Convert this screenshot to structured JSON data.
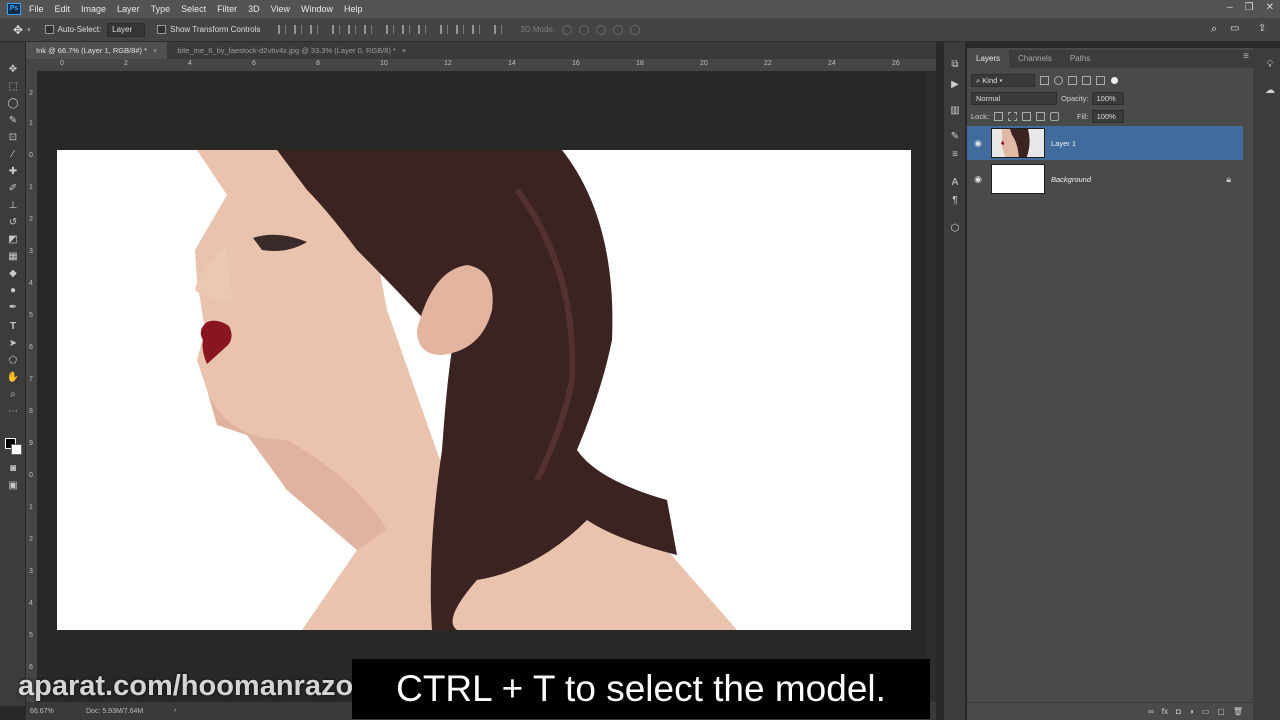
{
  "app": {
    "logo": "Ps",
    "menu": [
      "File",
      "Edit",
      "Image",
      "Layer",
      "Type",
      "Select",
      "Filter",
      "3D",
      "View",
      "Window",
      "Help"
    ],
    "window_controls": [
      "–",
      "❐",
      "✕"
    ]
  },
  "options_bar": {
    "auto_select_label": "Auto-Select:",
    "auto_select_value": "Layer",
    "show_transform_label": "Show Transform Controls",
    "mode_3d_label": "3D Mode:"
  },
  "tabs": [
    {
      "label": "Ink @ 66.7% (Layer 1, RGB/8#) *",
      "close": "×"
    },
    {
      "label": "bite_me_6_by_faestock-d2vbv4z.jpg @ 33.3% (Layer 0, RGB/8) *",
      "close": "×"
    }
  ],
  "ruler": {
    "top": [
      "0",
      "1",
      "2",
      "3",
      "4",
      "5",
      "6",
      "7",
      "8",
      "9",
      "10",
      "11",
      "12",
      "13",
      "14",
      "15",
      "16",
      "17",
      "18",
      "19",
      "20",
      "21",
      "22",
      "23",
      "24",
      "25",
      "26"
    ],
    "left": [
      "2",
      "1",
      "0",
      "1",
      "2",
      "3",
      "4",
      "5",
      "6",
      "7",
      "8",
      "9",
      "0",
      "1",
      "2",
      "3",
      "4",
      "5",
      "6"
    ]
  },
  "status": {
    "zoom": "66.67%",
    "doc": "Doc: 5.93M/7.64M",
    "arrow": "›"
  },
  "layers_panel": {
    "tabs": [
      "Layers",
      "Channels",
      "Paths"
    ],
    "filter_kind": "Kind",
    "blend_mode": "Normal",
    "opacity_label": "Opacity:",
    "opacity_value": "100%",
    "lock_label": "Lock:",
    "fill_label": "Fill:",
    "fill_value": "100%",
    "layers": [
      {
        "name": "Layer 1",
        "selected": true,
        "visible": true
      },
      {
        "name": "Background",
        "selected": false,
        "visible": true,
        "locked": true
      }
    ],
    "footer_icons": [
      "∞",
      "fx",
      "◘",
      "◑",
      "▭",
      "▢",
      "🗑"
    ]
  },
  "overlay": {
    "caption": "CTRL + T to select the model.",
    "watermark": "aparat.com/hoomanrazor"
  },
  "colors": {
    "selected_layer": "#3f6c9c",
    "hair": "#3b2322",
    "skin": "#e8c2ad",
    "lips": "#8a1520"
  }
}
